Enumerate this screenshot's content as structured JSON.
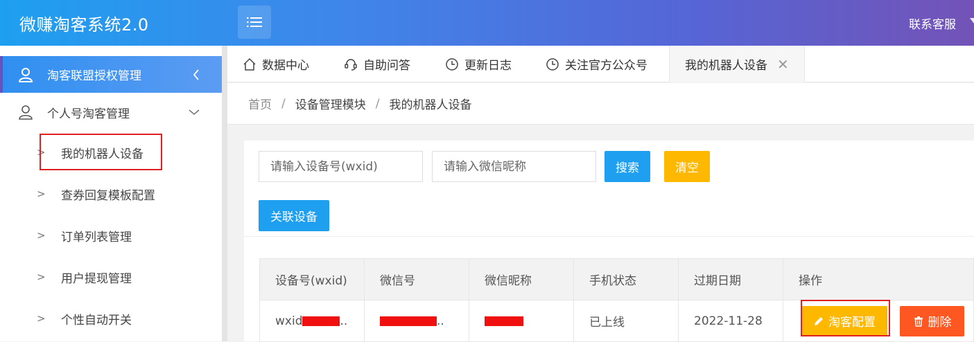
{
  "header": {
    "logo": "微赚淘客系统2.0",
    "contact": "联系客服"
  },
  "sidebar": {
    "active_item": {
      "label": "淘客联盟授权管理",
      "icon": "user-icon",
      "caret": "chevron-left-icon"
    },
    "group": {
      "label": "个人号淘客管理",
      "icon": "user-icon",
      "caret": "chevron-down-icon"
    },
    "sub_items": [
      {
        "label": "我的机器人设备"
      },
      {
        "label": "查券回复模板配置"
      },
      {
        "label": "订单列表管理"
      },
      {
        "label": "用户提现管理"
      },
      {
        "label": "个性自动开关"
      }
    ]
  },
  "tabs": [
    {
      "label": "数据中心",
      "icon": "home-icon"
    },
    {
      "label": "自助问答",
      "icon": "headset-icon"
    },
    {
      "label": "更新日志",
      "icon": "clock-icon"
    },
    {
      "label": "关注官方公众号",
      "icon": "clock-icon"
    },
    {
      "label": "我的机器人设备",
      "active": true
    }
  ],
  "breadcrumb": {
    "home": "首页",
    "sep": "/",
    "module": "设备管理模块",
    "current": "我的机器人设备"
  },
  "search": {
    "wxid_placeholder": "请输入设备号(wxid)",
    "nickname_placeholder": "请输入微信昵称",
    "search_label": "搜索",
    "clear_label": "清空",
    "link_label": "关联设备"
  },
  "table": {
    "headers": [
      "设备号(wxid)",
      "微信号",
      "微信昵称",
      "手机状态",
      "过期日期",
      "操作"
    ],
    "rows": [
      {
        "wxid": "wxid",
        "wxid_suffix": "..",
        "wechat_id_suffix": "..",
        "status": "已上线",
        "expire": "2022-11-28",
        "config_label": "淘客配置",
        "delete_label": "删除"
      }
    ]
  },
  "colors": {
    "primary": "#1e9ff0",
    "warning": "#ffb800",
    "danger": "#ff5722",
    "highlight_box": "#e02020"
  }
}
